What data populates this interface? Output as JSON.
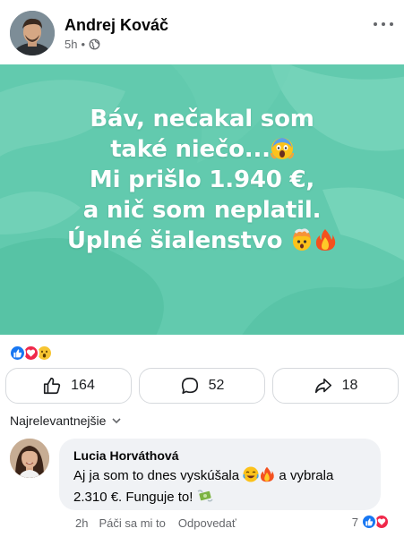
{
  "post": {
    "author": "Andrej Kováč",
    "time": "5h",
    "separator": "•",
    "privacy_icon": "globe-icon",
    "more_icon": "more-dots-icon",
    "image_text": {
      "line1": "Báv, nečakal som",
      "line2": "také niečo...",
      "line3": "Mi prišlo 1.940 €,",
      "line4": "a nič som neplatil.",
      "line5": "Úplné šialenstvo"
    },
    "image_colors": {
      "base": "#5fc9ad",
      "light": "#8fe0c8",
      "dark": "#3fb595"
    }
  },
  "reactions": {
    "icons": [
      "like-reaction-icon",
      "love-reaction-icon",
      "wow-reaction-icon"
    ],
    "colors": {
      "like": "#1877f2",
      "love": "#f0284a",
      "wow": "#f7c531"
    }
  },
  "actions": {
    "like_count": "164",
    "comment_count": "52",
    "share_count": "18"
  },
  "comments_sort": {
    "label": "Najrelevantnejšie"
  },
  "comment": {
    "author": "Lucia Horváthová",
    "text_part1": "Aj ja som to dnes vyskúšala",
    "text_part2": " a vybrala",
    "text_part3": "2.310 €. Funguje to!",
    "time": "2h",
    "like_label": "Páči sa mi to",
    "reply_label": "Odpovedať",
    "reaction_count": "7"
  }
}
